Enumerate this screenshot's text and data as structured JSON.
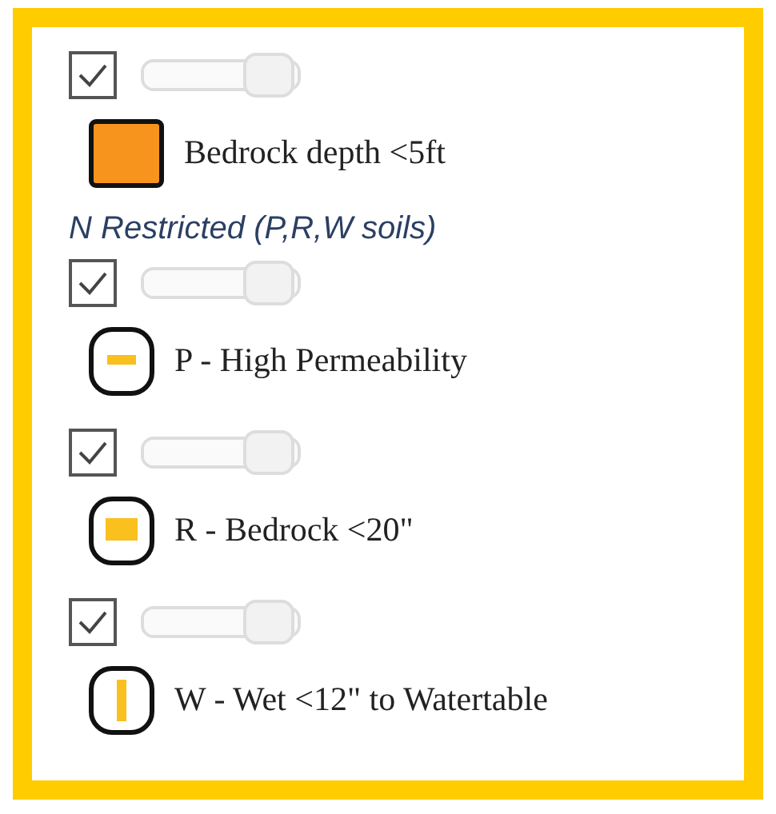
{
  "items": [
    {
      "kind": "layer",
      "checked": true,
      "level": 1,
      "swatch": {
        "kind": "fill",
        "color": "#f7941d"
      },
      "label": "Bedrock depth <5ft"
    },
    {
      "kind": "heading",
      "label": "N Restricted (P,R,W soils)"
    },
    {
      "kind": "layer",
      "checked": true,
      "level": 1,
      "swatch": {
        "kind": "hbar",
        "color": "#f9c01e"
      },
      "label": "P - High Permeability"
    },
    {
      "kind": "layer",
      "checked": true,
      "level": 1,
      "swatch": {
        "kind": "square",
        "color": "#f9c01e"
      },
      "label": "R - Bedrock <20\""
    },
    {
      "kind": "layer",
      "checked": true,
      "level": 1,
      "swatch": {
        "kind": "vbar",
        "color": "#f9c01e"
      },
      "label": "W - Wet <12\" to Watertable"
    }
  ]
}
